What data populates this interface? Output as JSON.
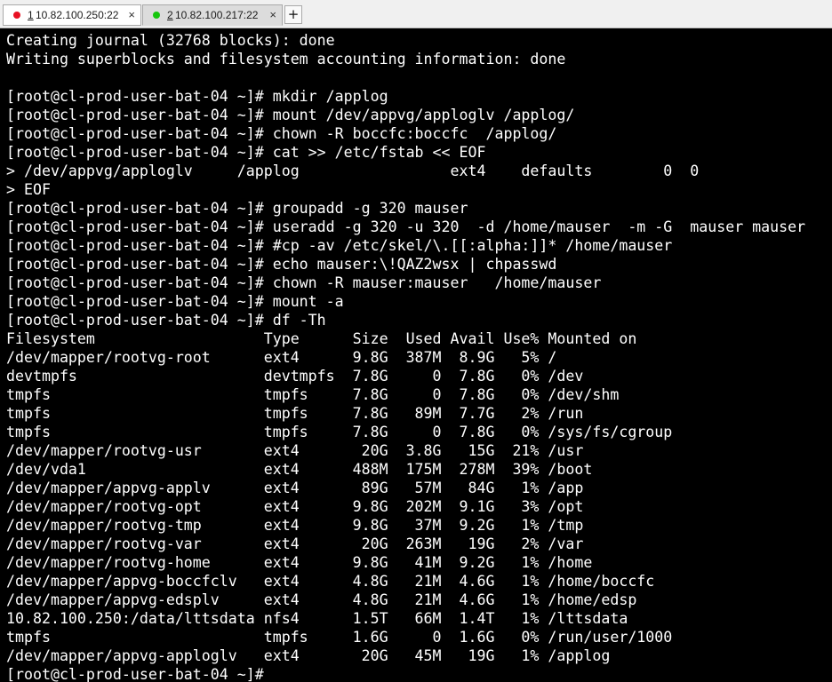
{
  "tabs": [
    {
      "number": "1",
      "label": " 10.82.100.250:22",
      "close": "×",
      "status_color": "#e81123",
      "active": false
    },
    {
      "number": "2",
      "label": " 10.82.100.217:22",
      "close": "×",
      "status_color": "#16c60c",
      "active": true
    }
  ],
  "new_tab_label": "+",
  "terminal": {
    "lines": [
      "Creating journal (32768 blocks): done",
      "Writing superblocks and filesystem accounting information: done",
      "",
      "[root@cl-prod-user-bat-04 ~]# mkdir /applog",
      "[root@cl-prod-user-bat-04 ~]# mount /dev/appvg/apploglv /applog/",
      "[root@cl-prod-user-bat-04 ~]# chown -R boccfc:boccfc  /applog/",
      "[root@cl-prod-user-bat-04 ~]# cat >> /etc/fstab << EOF",
      "> /dev/appvg/apploglv     /applog                 ext4    defaults        0  0",
      "> EOF",
      "[root@cl-prod-user-bat-04 ~]# groupadd -g 320 mauser",
      "[root@cl-prod-user-bat-04 ~]# useradd -g 320 -u 320  -d /home/mauser  -m -G  mauser mauser",
      "[root@cl-prod-user-bat-04 ~]# #cp -av /etc/skel/\\.[[:alpha:]]* /home/mauser",
      "[root@cl-prod-user-bat-04 ~]# echo mauser:\\!QAZ2wsx | chpasswd",
      "[root@cl-prod-user-bat-04 ~]# chown -R mauser:mauser   /home/mauser",
      "[root@cl-prod-user-bat-04 ~]# mount -a",
      "[root@cl-prod-user-bat-04 ~]# df -Th",
      "Filesystem                   Type      Size  Used Avail Use% Mounted on",
      "/dev/mapper/rootvg-root      ext4      9.8G  387M  8.9G   5% /",
      "devtmpfs                     devtmpfs  7.8G     0  7.8G   0% /dev",
      "tmpfs                        tmpfs     7.8G     0  7.8G   0% /dev/shm",
      "tmpfs                        tmpfs     7.8G   89M  7.7G   2% /run",
      "tmpfs                        tmpfs     7.8G     0  7.8G   0% /sys/fs/cgroup",
      "/dev/mapper/rootvg-usr       ext4       20G  3.8G   15G  21% /usr",
      "/dev/vda1                    ext4      488M  175M  278M  39% /boot",
      "/dev/mapper/appvg-applv      ext4       89G   57M   84G   1% /app",
      "/dev/mapper/rootvg-opt       ext4      9.8G  202M  9.1G   3% /opt",
      "/dev/mapper/rootvg-tmp       ext4      9.8G   37M  9.2G   1% /tmp",
      "/dev/mapper/rootvg-var       ext4       20G  263M   19G   2% /var",
      "/dev/mapper/rootvg-home      ext4      9.8G   41M  9.2G   1% /home",
      "/dev/mapper/appvg-boccfclv   ext4      4.8G   21M  4.6G   1% /home/boccfc",
      "/dev/mapper/appvg-edsplv     ext4      4.8G   21M  4.6G   1% /home/edsp",
      "10.82.100.250:/data/lttsdata nfs4      1.5T   66M  1.4T   1% /lttsdata",
      "tmpfs                        tmpfs     1.6G     0  1.6G   0% /run/user/1000",
      "/dev/mapper/appvg-apploglv   ext4       20G   45M   19G   1% /applog",
      "[root@cl-prod-user-bat-04 ~]# "
    ]
  }
}
